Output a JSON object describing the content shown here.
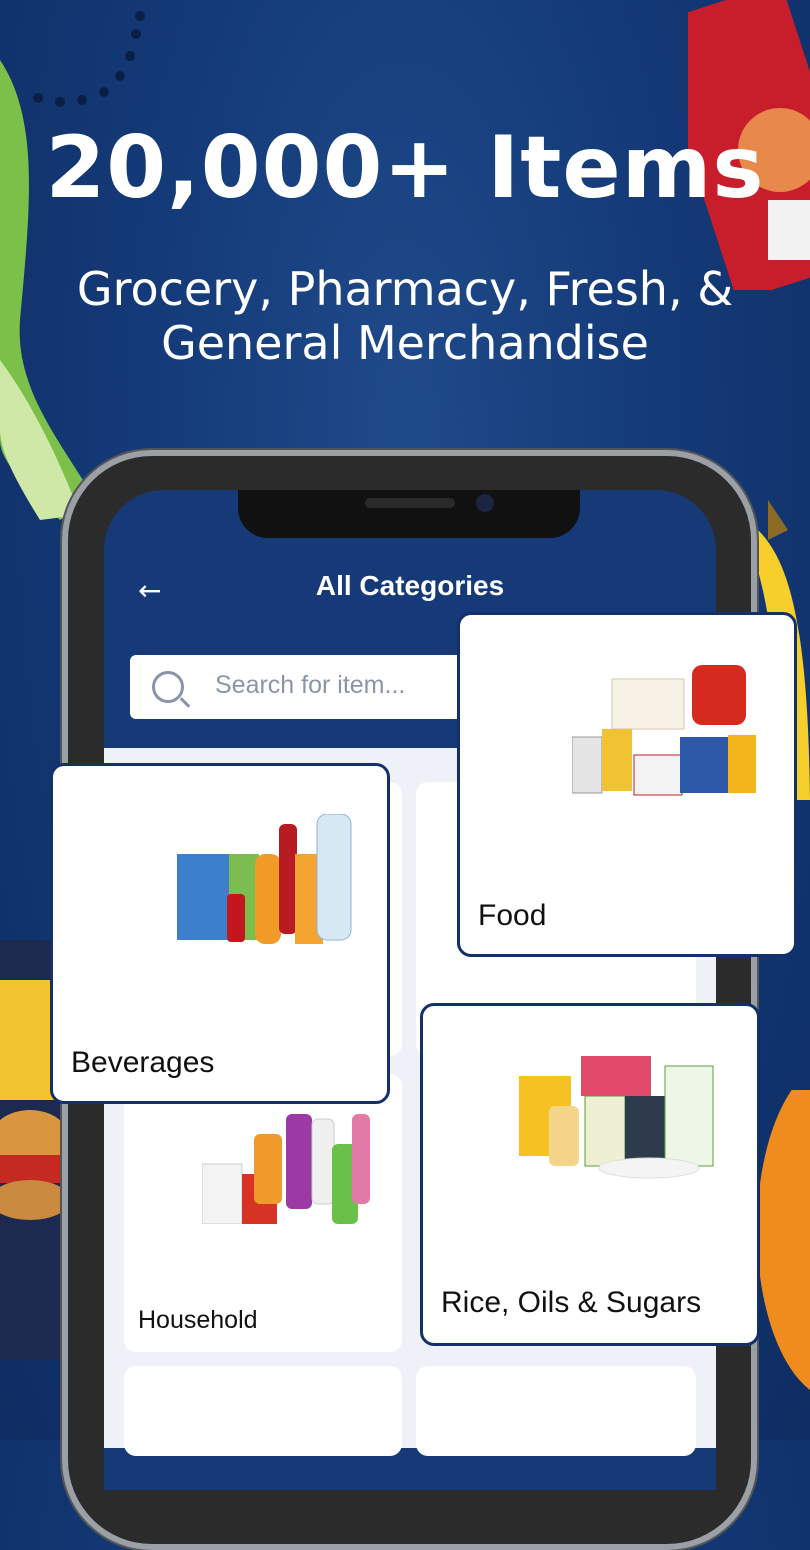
{
  "promo": {
    "headline": "20,000+ Items",
    "subline": "Grocery, Pharmacy, Fresh, & General Merchandise"
  },
  "app": {
    "title": "All Categories",
    "back_icon": "arrow-left-icon",
    "search": {
      "placeholder": "Search for item...",
      "icon": "search-icon"
    },
    "categories": [
      {
        "label": "Beverages"
      },
      {
        "label": "Food"
      },
      {
        "label": "Household"
      },
      {
        "label": "Rice, Oils & Sugars"
      }
    ]
  },
  "colors": {
    "brand_navy": "#143a78",
    "card_border": "#14306a"
  }
}
